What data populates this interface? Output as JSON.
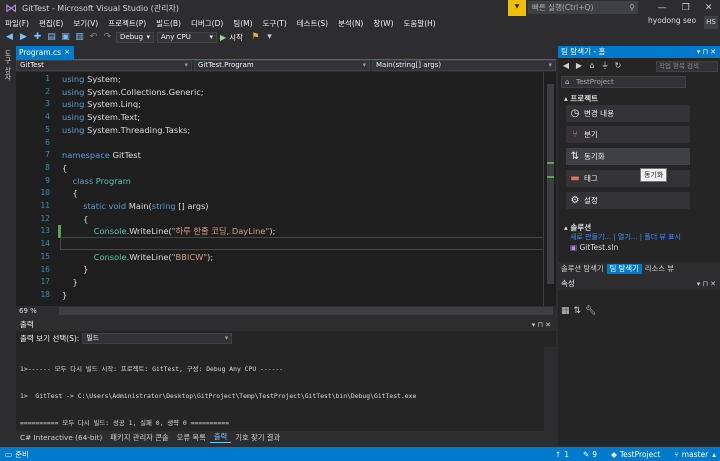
{
  "window": {
    "title": "GitTest - Microsoft Visual Studio (관리자)",
    "quick_launch_placeholder": "빠른 실행(Ctrl+Q)",
    "user": "hyodong seo",
    "user_initials": "HS",
    "min": "—",
    "max": "❐",
    "close": "✕"
  },
  "menu": [
    "파일(F)",
    "편집(E)",
    "보기(V)",
    "프로젝트(P)",
    "빌드(B)",
    "디버그(D)",
    "팀(M)",
    "도구(T)",
    "테스트(S)",
    "분석(N)",
    "창(W)",
    "도움말(H)"
  ],
  "toolbar": {
    "config": "Debug",
    "platform": "Any CPU",
    "start": "시작"
  },
  "left_strip": {
    "label": "도구 상자"
  },
  "doc_tab": {
    "name": "Program.cs",
    "close": "×"
  },
  "navbar": {
    "project": "GitTest",
    "class": "GitTest.Program",
    "member": "Main(string[] args)"
  },
  "editor": {
    "line_numbers": [
      "1",
      "2",
      "3",
      "4",
      "5",
      "6",
      "7",
      "8",
      "9",
      "10",
      "11",
      "12",
      "13",
      "14",
      "15",
      "16",
      "17",
      "18"
    ],
    "zoom": "69 %"
  },
  "output": {
    "title": "출력",
    "show_from_label": "출력 보기 선택(S):",
    "show_from_value": "빌드",
    "lines": [
      "1>------ 모두 다시 빌드 시작: 프로젝트: GitTest, 구성: Debug Any CPU ------",
      "1>  GitTest -> C:\\Users\\Administrator\\Desktop\\GitProject\\Temp\\TestProject\\GitTest\\bin\\Debug\\GitTest.exe",
      "========== 모두 다시 빌드: 성공 1, 실패 0, 생략 0 =========="
    ],
    "pin": "▾ ⊓ ✕"
  },
  "bottom_tabs": [
    "C# Interactive (64-bit)",
    "패키지 관리자 콘솔",
    "오류 목록",
    "출력",
    "기호 찾기 결과"
  ],
  "bottom_tabs_active": "출력",
  "status": {
    "ready": "준비",
    "up": "1",
    "pencil": "9",
    "project": "TestProject",
    "branch": "master"
  },
  "team_explorer": {
    "title": "팀 탐색기 - 홈",
    "search_placeholder": "작업 항목 검색",
    "project": "TestProject",
    "section": "프로젝트",
    "nav_items": [
      {
        "label": "변경 내용",
        "icon": "◷"
      },
      {
        "label": "분기",
        "icon": "⑂"
      },
      {
        "label": "동기화",
        "icon": "⇅"
      },
      {
        "label": "태그",
        "icon": "▬"
      },
      {
        "label": "설정",
        "icon": "⚙"
      }
    ],
    "tooltip": "동기화",
    "solutions_title": "솔루션",
    "solution_links": "새로 만들기... | 열기... | 폴더 뷰 표시",
    "solution_file": "GitTest.sln"
  },
  "te_tabs": [
    "솔루션 탐색기",
    "팀 탐색기",
    "리소스 뷰"
  ],
  "te_tab_active": "팀 탐색기",
  "properties": {
    "title": "속성"
  },
  "colors": {
    "accent": "#007acc",
    "editor_bg": "#1e1e1e",
    "keyword": "#569cd6",
    "type": "#4ec9b0",
    "string": "#d69d85"
  }
}
